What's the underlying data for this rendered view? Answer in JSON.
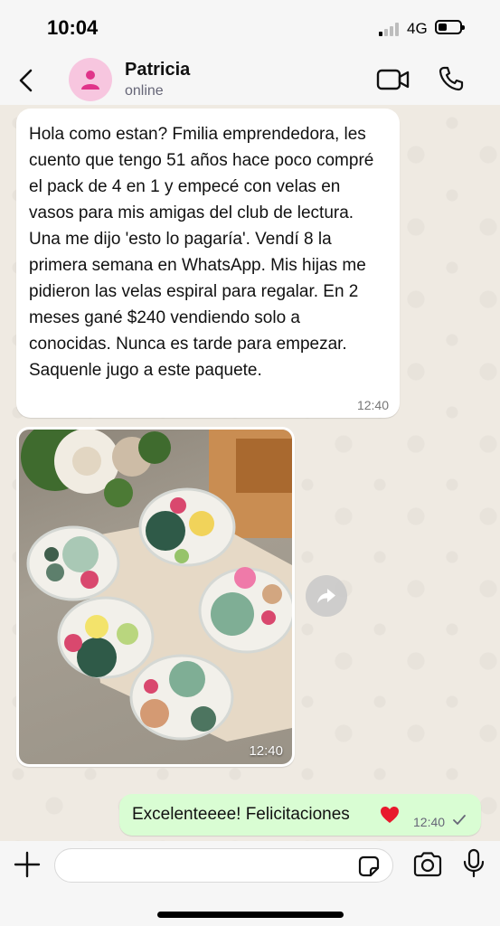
{
  "status_bar": {
    "time": "10:04",
    "network": "4G",
    "battery_level": 0.4
  },
  "header": {
    "contact_name": "Patricia",
    "contact_status": "online",
    "avatar_color": "#f7c6df",
    "avatar_icon": "person-icon"
  },
  "messages": [
    {
      "direction": "incoming",
      "type": "text",
      "text": "Hola como estan? Fmilia emprendedora, les cuento que tengo 51 años hace poco compré el pack de 4 en 1 y empecé con velas en vasos para mis amigas del club de lectura. Una me dijo 'esto lo pagaría'. Vendí 8 la primera semana en WhatsApp. Mis hijas me pidieron las velas espiral para regalar. En 2 meses gané $240 vendiendo solo a conocidas. Nunca es tarde para empezar. Saquenle jugo a este paquete.",
      "time": "12:40"
    },
    {
      "direction": "incoming",
      "type": "image",
      "time": "12:40"
    },
    {
      "direction": "outgoing",
      "type": "text",
      "text": "Excelenteeee! Felicitaciones",
      "emoji": "red-heart",
      "time": "12:40",
      "status": "sent"
    }
  ],
  "input": {
    "placeholder": "",
    "value": ""
  },
  "colors": {
    "chat_bg": "#efeae2",
    "outgoing_bubble": "#d9fdd3",
    "incoming_bubble": "#ffffff",
    "bars": "#f6f6f6"
  }
}
